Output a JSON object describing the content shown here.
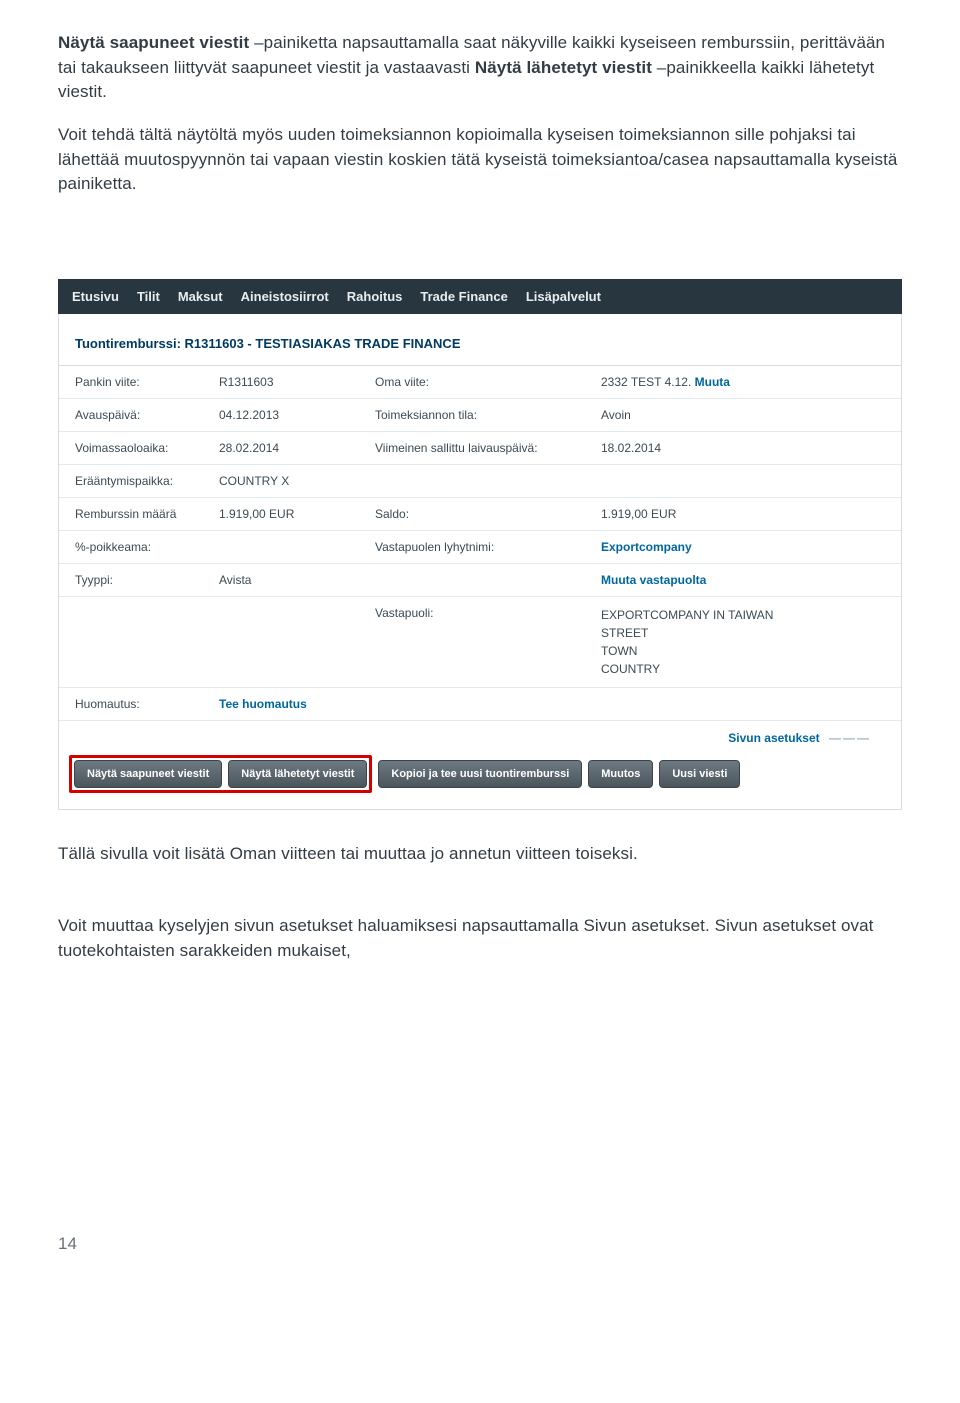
{
  "intro": {
    "p1_a": "Näytä saapuneet viestit",
    "p1_b": " –painiketta napsauttamalla saat näkyville kaikki kyseiseen remburssiin, perittävään tai takaukseen liittyvät saapuneet viestit ja vastaavasti ",
    "p1_c": "Näytä lähetetyt viestit",
    "p1_d": " –painikkeella kaikki lähetetyt viestit.",
    "p2": "Voit tehdä tältä näytöltä myös uuden toimeksiannon kopioimalla kyseisen toimeksiannon sille pohjaksi tai lähettää muutospyynnön tai vapaan viestin koskien tätä kyseistä toimeksiantoa/casea napsauttamalla kyseistä painiketta."
  },
  "nav": [
    "Etusivu",
    "Tilit",
    "Maksut",
    "Aineistosiirrot",
    "Rahoitus",
    "Trade Finance",
    "Lisäpalvelut"
  ],
  "section_title": "Tuontiremburssi: R1311603 - TESTIASIAKAS TRADE FINANCE",
  "rows": [
    {
      "l1": "Pankin viite:",
      "v1": "R1311603",
      "l2": "Oma viite:",
      "v2": "2332 TEST 4.12. ",
      "v2link": "Muuta",
      "linkOnly": false
    },
    {
      "l1": "Avauspäivä:",
      "v1": "04.12.2013",
      "l2": "Toimeksiannon tila:",
      "v2": "Avoin"
    },
    {
      "l1": "Voimassaoloaika:",
      "v1": "28.02.2014",
      "l2": "Viimeinen sallittu laivauspäivä:",
      "v2": "18.02.2014"
    },
    {
      "l1": "Erääntymispaikka:",
      "v1": "COUNTRY X",
      "l2": "",
      "v2": ""
    },
    {
      "l1": "Remburssin määrä",
      "v1": "1.919,00 EUR",
      "l2": "Saldo:",
      "v2": "1.919,00 EUR"
    },
    {
      "l1": "%-poikkeama:",
      "v1": "",
      "l2": "Vastapuolen lyhytnimi:",
      "v2link": "Exportcompany",
      "linkOnly": true
    },
    {
      "l1": "Tyyppi:",
      "v1": "Avista",
      "l2": "",
      "v2link": "Muuta vastapuolta",
      "linkOnly": true
    }
  ],
  "vastapuoli": {
    "label": "Vastapuoli:",
    "lines": [
      "EXPORTCOMPANY IN TAIWAN",
      "STREET",
      "TOWN",
      "COUNTRY"
    ]
  },
  "huomautus": {
    "label": "Huomautus:",
    "link": "Tee huomautus"
  },
  "settings_label": "Sivun asetukset",
  "buttons": {
    "b1": "Näytä saapuneet viestit",
    "b2": "Näytä lähetetyt viestit",
    "b3": "Kopioi ja tee uusi tuontiremburssi",
    "b4": "Muutos",
    "b5": "Uusi viesti"
  },
  "outro": {
    "p3_a": "Tällä sivulla voit lisätä ",
    "p3_b": "Oman viitteen",
    "p3_c": "  tai muuttaa jo annetun viitteen toiseksi.",
    "p4": "Voit muuttaa kyselyjen sivun asetukset haluamiksesi napsauttamalla Sivun asetukset. Sivun asetukset ovat tuotekohtaisten sarakkeiden mukaiset,"
  },
  "page_number": "14"
}
